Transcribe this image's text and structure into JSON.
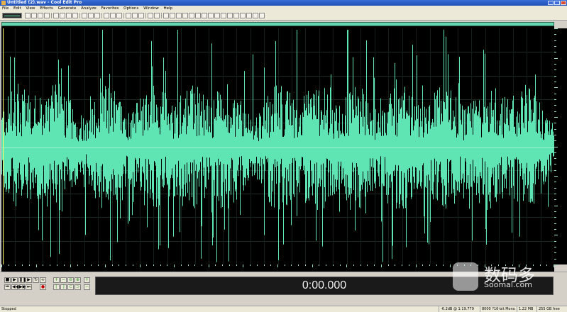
{
  "window": {
    "title": "Untitled (2).wav - Cool Edit Pro"
  },
  "menu": [
    "File",
    "Edit",
    "View",
    "Effects",
    "Generate",
    "Analyze",
    "Favorites",
    "Options",
    "Window",
    "Help"
  ],
  "display": {
    "time": "0:00.000"
  },
  "status": {
    "state": "Stopped",
    "selection_info": "-6.2dB @  1:19.779",
    "format": "8000 ?16-bit Mono",
    "size": "1.22 MB",
    "free": "255 GB free"
  },
  "watermark": {
    "chinese": "数码多",
    "site": "Soomal.com"
  },
  "colors": {
    "waveform": "#5fe5b4",
    "background": "#000000",
    "overview": "#64d5ae"
  }
}
